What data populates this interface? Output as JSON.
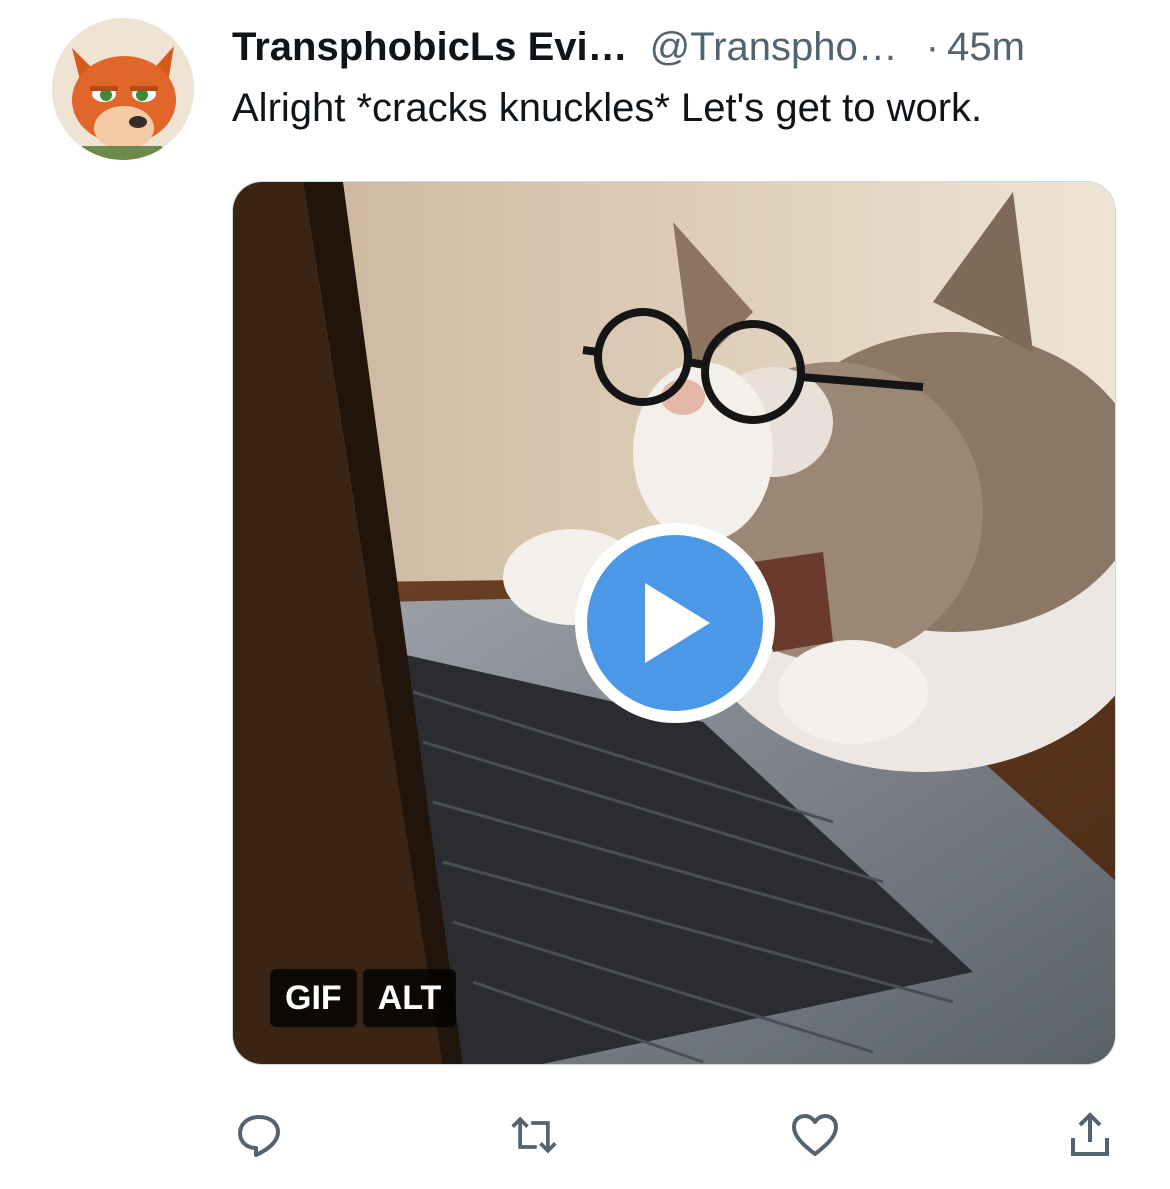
{
  "tweet": {
    "display_name": "TransphobicLs Evi…",
    "handle": "@Transpho…",
    "separator": "·",
    "time": "45m",
    "text": "Alright *cracks knuckles* Let's get to work."
  },
  "media": {
    "type": "animated gif",
    "badges": {
      "gif": "GIF",
      "alt": "ALT"
    },
    "play_icon": "play-icon"
  },
  "actions": [
    {
      "icon": "reply-icon"
    },
    {
      "icon": "retweet-icon"
    },
    {
      "icon": "like-icon"
    },
    {
      "icon": "share-icon"
    }
  ],
  "colors": {
    "play_button": "#4a98e6",
    "secondary_text": "#536471",
    "icon": "#536471"
  }
}
